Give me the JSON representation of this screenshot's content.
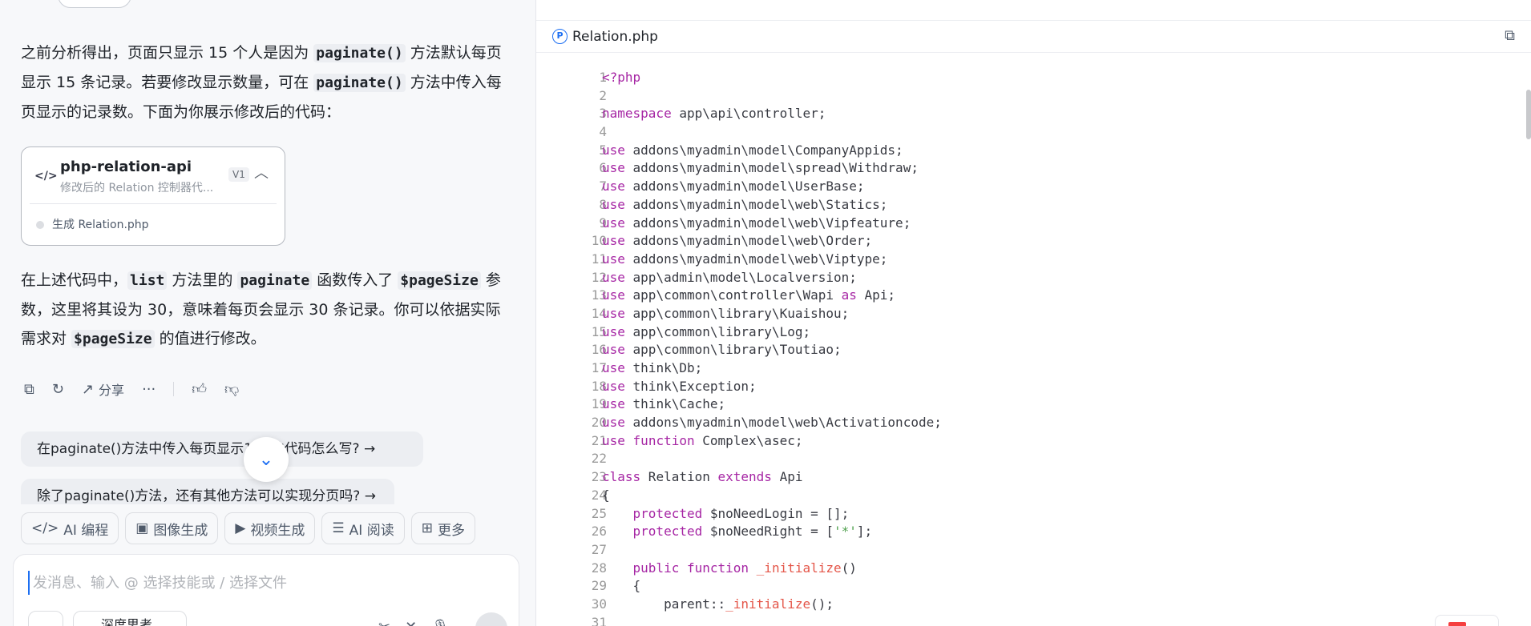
{
  "chat": {
    "para1": {
      "t1": "之前分析得出，页面只显示 15 个人是因为 ",
      "c1": "paginate()",
      "t2": " 方法默认每页显示 15 条记录。若要修改显示数量，可在 ",
      "c2": "paginate()",
      "t3": " 方法中传入每页显示的记录数。下面为你展示修改后的代码："
    },
    "artifact": {
      "title": "php-relation-api",
      "subtitle": "修改后的 Relation 控制器代...",
      "version": "V1",
      "status": "生成 Relation.php"
    },
    "para2": {
      "t1": "在上述代码中，",
      "c1": "list",
      "t2": " 方法里的 ",
      "c2": "paginate",
      "t3": " 函数传入了 ",
      "c3": "$pageSize",
      "t4": " 参数，这里将其设为 30，意味着每页会显示 30 条记录。你可以依据实际需求对 ",
      "c4": "$pageSize",
      "t5": " 的值进行修改。"
    },
    "actions": {
      "share_label": "分享"
    },
    "suggestions": [
      "在paginate()方法中传入每页显示1 录的代码怎么写?",
      "除了paginate()方法，还有其他方法可以实现分页吗?"
    ],
    "skills": [
      "AI 编程",
      "图像生成",
      "视频生成",
      "AI 阅读",
      "更多"
    ],
    "composer": {
      "placeholder": "发消息、输入 @ 选择技能或 / 选择文件",
      "deep_think_label": "深度思考"
    }
  },
  "code_pane": {
    "file_name": "Relation.php",
    "lines": [
      [
        {
          "c": "kw",
          "t": "<?php"
        }
      ],
      [],
      [
        {
          "c": "kw",
          "t": "namespace"
        },
        {
          "t": " app\\api\\controller;"
        }
      ],
      [],
      [
        {
          "c": "kw",
          "t": "use"
        },
        {
          "t": " addons\\myadmin\\model\\CompanyAppids;"
        }
      ],
      [
        {
          "c": "kw",
          "t": "use"
        },
        {
          "t": " addons\\myadmin\\model\\spread\\Withdraw;"
        }
      ],
      [
        {
          "c": "kw",
          "t": "use"
        },
        {
          "t": " addons\\myadmin\\model\\UserBase;"
        }
      ],
      [
        {
          "c": "kw",
          "t": "use"
        },
        {
          "t": " addons\\myadmin\\model\\web\\Statics;"
        }
      ],
      [
        {
          "c": "kw",
          "t": "use"
        },
        {
          "t": " addons\\myadmin\\model\\web\\Vipfeature;"
        }
      ],
      [
        {
          "c": "kw",
          "t": "use"
        },
        {
          "t": " addons\\myadmin\\model\\web\\Order;"
        }
      ],
      [
        {
          "c": "kw",
          "t": "use"
        },
        {
          "t": " addons\\myadmin\\model\\web\\Viptype;"
        }
      ],
      [
        {
          "c": "kw",
          "t": "use"
        },
        {
          "t": " app\\admin\\model\\Localversion;"
        }
      ],
      [
        {
          "c": "kw",
          "t": "use"
        },
        {
          "t": " app\\common\\controller\\Wapi "
        },
        {
          "c": "kw",
          "t": "as"
        },
        {
          "t": " Api;"
        }
      ],
      [
        {
          "c": "kw",
          "t": "use"
        },
        {
          "t": " app\\common\\library\\Kuaishou;"
        }
      ],
      [
        {
          "c": "kw",
          "t": "use"
        },
        {
          "t": " app\\common\\library\\Log;"
        }
      ],
      [
        {
          "c": "kw",
          "t": "use"
        },
        {
          "t": " app\\common\\library\\Toutiao;"
        }
      ],
      [
        {
          "c": "kw",
          "t": "use"
        },
        {
          "t": " think\\Db;"
        }
      ],
      [
        {
          "c": "kw",
          "t": "use"
        },
        {
          "t": " think\\Exception;"
        }
      ],
      [
        {
          "c": "kw",
          "t": "use"
        },
        {
          "t": " think\\Cache;"
        }
      ],
      [
        {
          "c": "kw",
          "t": "use"
        },
        {
          "t": " addons\\myadmin\\model\\web\\Activationcode;"
        }
      ],
      [
        {
          "c": "kw",
          "t": "use"
        },
        {
          "t": " "
        },
        {
          "c": "kw",
          "t": "function"
        },
        {
          "t": " Complex\\asec;"
        }
      ],
      [],
      [
        {
          "c": "kw",
          "t": "class"
        },
        {
          "t": " Relation "
        },
        {
          "c": "kw",
          "t": "extends"
        },
        {
          "t": " Api"
        }
      ],
      [
        {
          "t": "{"
        }
      ],
      [
        {
          "t": "    "
        },
        {
          "c": "kw",
          "t": "protected"
        },
        {
          "t": " $noNeedLogin = [];"
        }
      ],
      [
        {
          "t": "    "
        },
        {
          "c": "kw",
          "t": "protected"
        },
        {
          "t": " $noNeedRight = ["
        },
        {
          "c": "st",
          "t": "'*'"
        },
        {
          "t": "];"
        }
      ],
      [],
      [
        {
          "t": "    "
        },
        {
          "c": "kw",
          "t": "public"
        },
        {
          "t": " "
        },
        {
          "c": "kw",
          "t": "function"
        },
        {
          "t": " "
        },
        {
          "c": "fn",
          "t": "_initialize"
        },
        {
          "t": "()"
        }
      ],
      [
        {
          "t": "    {"
        }
      ],
      [
        {
          "t": "        parent::"
        },
        {
          "c": "fn",
          "t": "_initialize"
        },
        {
          "t": "();"
        }
      ],
      []
    ]
  },
  "icons": {
    "code": "code-icon",
    "chevron_up": "chevron-up-icon",
    "copy": "copy-icon",
    "refresh": "refresh-icon",
    "share": "share-icon",
    "more": "more-icon",
    "thumbs_up": "thumbs-up-icon",
    "thumbs_down": "thumbs-down-icon",
    "arrow_right": "arrow-right-icon",
    "chevron_down": "chevron-down-icon",
    "php_file": "php-file-icon"
  },
  "colors": {
    "accent": "#1d6ff2",
    "keyword": "#a626a4",
    "function": "#e45649",
    "string": "#50a14f"
  }
}
